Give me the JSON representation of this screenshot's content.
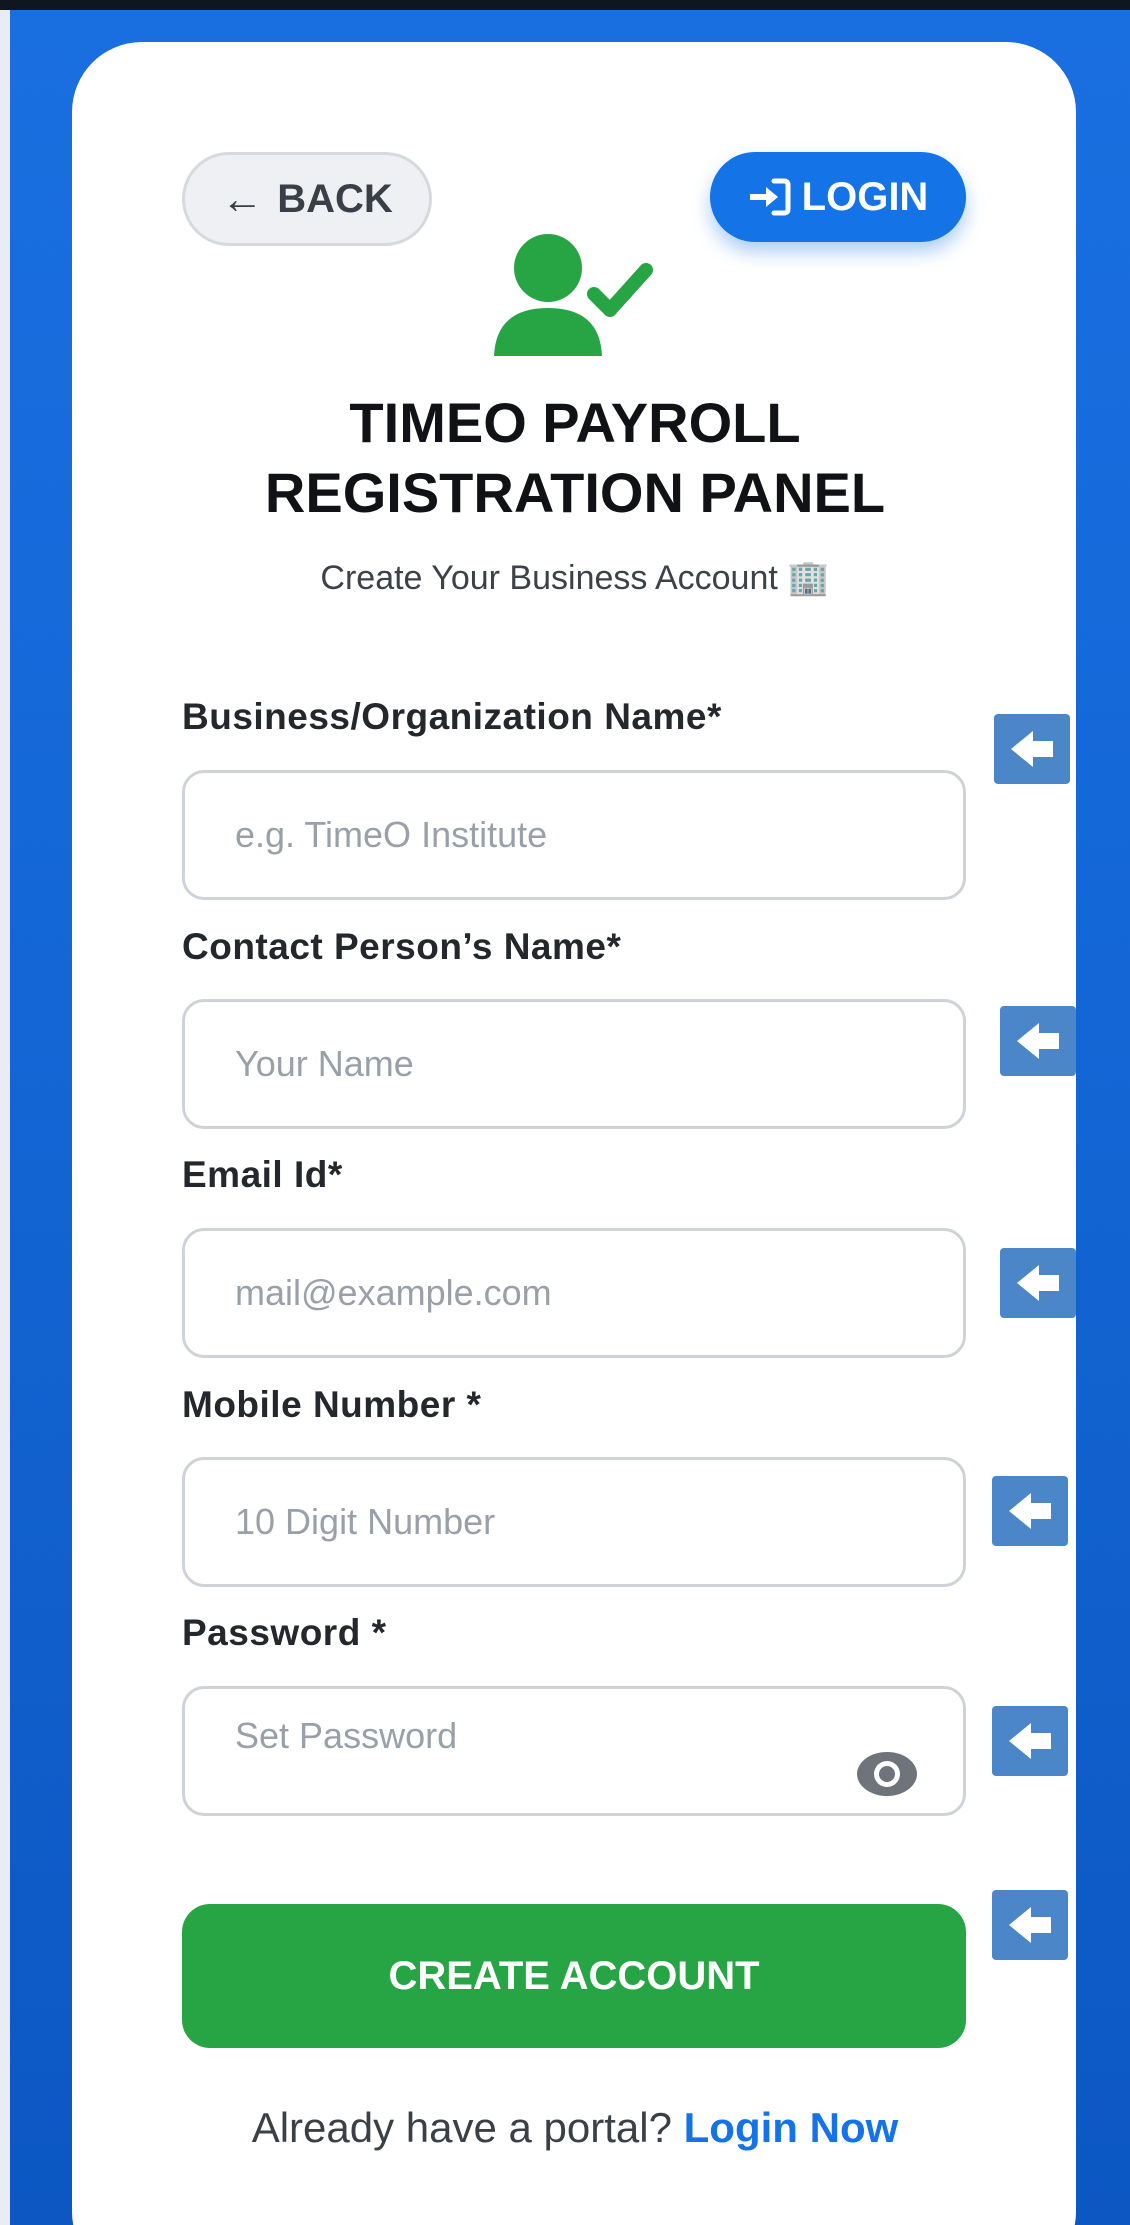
{
  "nav": {
    "back_label": "BACK",
    "login_label": "LOGIN"
  },
  "header": {
    "title_line1": "TIMEO PAYROLL",
    "title_line2": "REGISTRATION PANEL",
    "subtitle": "Create Your Business Account 🏢"
  },
  "form": {
    "fields": [
      {
        "label": "Business/Organization Name*",
        "placeholder": "e.g. TimeO Institute"
      },
      {
        "label": "Contact Person’s Name*",
        "placeholder": "Your Name"
      },
      {
        "label": "Email Id*",
        "placeholder": "mail@example.com"
      },
      {
        "label": "Mobile Number *",
        "placeholder": "10 Digit Number"
      },
      {
        "label": "Password *",
        "placeholder": "Set Password"
      }
    ],
    "submit_label": "CREATE ACCOUNT"
  },
  "footer": {
    "prompt": "Already have a portal?",
    "link_label": "Login Now"
  },
  "colors": {
    "primary_blue": "#1473e6",
    "success_green": "#27a444",
    "side_arrow": "#4a86c8"
  },
  "icons": [
    "arrow-left-icon",
    "sign-in-icon",
    "user-check-icon",
    "eye-icon"
  ]
}
